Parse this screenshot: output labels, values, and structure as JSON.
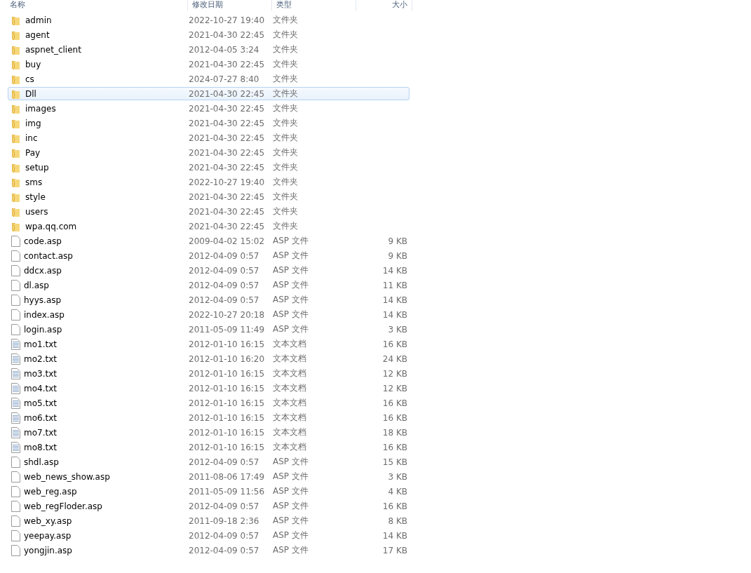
{
  "columns": [
    "名称",
    "修改日期",
    "类型",
    "大小"
  ],
  "rows": [
    {
      "name": "admin",
      "date": "2022-10-27 19:40",
      "type": "文件夹",
      "kind": "folder",
      "selected": false
    },
    {
      "name": "agent",
      "date": "2021-04-30 22:45",
      "type": "文件夹",
      "kind": "folder",
      "selected": false
    },
    {
      "name": "aspnet_client",
      "date": "2012-04-05 3:24",
      "type": "文件夹",
      "kind": "folder",
      "selected": false
    },
    {
      "name": "buy",
      "date": "2021-04-30 22:45",
      "type": "文件夹",
      "kind": "folder",
      "selected": false
    },
    {
      "name": "cs",
      "date": "2024-07-27 8:40",
      "type": "文件夹",
      "kind": "folder",
      "selected": false
    },
    {
      "name": "Dll",
      "date": "2021-04-30 22:45",
      "type": "文件夹",
      "kind": "folder",
      "selected": true
    },
    {
      "name": "images",
      "date": "2021-04-30 22:45",
      "type": "文件夹",
      "kind": "folder",
      "selected": false
    },
    {
      "name": "img",
      "date": "2021-04-30 22:45",
      "type": "文件夹",
      "kind": "folder",
      "selected": false
    },
    {
      "name": "inc",
      "date": "2021-04-30 22:45",
      "type": "文件夹",
      "kind": "folder",
      "selected": false
    },
    {
      "name": "Pay",
      "date": "2021-04-30 22:45",
      "type": "文件夹",
      "kind": "folder",
      "selected": false
    },
    {
      "name": "setup",
      "date": "2021-04-30 22:45",
      "type": "文件夹",
      "kind": "folder",
      "selected": false
    },
    {
      "name": "sms",
      "date": "2022-10-27 19:40",
      "type": "文件夹",
      "kind": "folder",
      "selected": false
    },
    {
      "name": "style",
      "date": "2021-04-30 22:45",
      "type": "文件夹",
      "kind": "folder",
      "selected": false
    },
    {
      "name": "users",
      "date": "2021-04-30 22:45",
      "type": "文件夹",
      "kind": "folder",
      "selected": false
    },
    {
      "name": "wpa.qq.com",
      "date": "2021-04-30 22:45",
      "type": "文件夹",
      "kind": "folder",
      "selected": false
    },
    {
      "name": "code.asp",
      "date": "2009-04-02 15:02",
      "type": "ASP 文件",
      "size": "9 KB",
      "kind": "file",
      "selected": false
    },
    {
      "name": "contact.asp",
      "date": "2012-04-09 0:57",
      "type": "ASP 文件",
      "size": "9 KB",
      "kind": "file",
      "selected": false
    },
    {
      "name": "ddcx.asp",
      "date": "2012-04-09 0:57",
      "type": "ASP 文件",
      "size": "14 KB",
      "kind": "file",
      "selected": false
    },
    {
      "name": "dl.asp",
      "date": "2012-04-09 0:57",
      "type": "ASP 文件",
      "size": "11 KB",
      "kind": "file",
      "selected": false
    },
    {
      "name": "hyys.asp",
      "date": "2012-04-09 0:57",
      "type": "ASP 文件",
      "size": "14 KB",
      "kind": "file",
      "selected": false
    },
    {
      "name": "index.asp",
      "date": "2022-10-27 20:18",
      "type": "ASP 文件",
      "size": "14 KB",
      "kind": "file",
      "selected": false
    },
    {
      "name": "login.asp",
      "date": "2011-05-09 11:49",
      "type": "ASP 文件",
      "size": "3 KB",
      "kind": "file",
      "selected": false
    },
    {
      "name": "mo1.txt",
      "date": "2012-01-10 16:15",
      "type": "文本文档",
      "size": "16 KB",
      "kind": "text",
      "selected": false
    },
    {
      "name": "mo2.txt",
      "date": "2012-01-10 16:20",
      "type": "文本文档",
      "size": "24 KB",
      "kind": "text",
      "selected": false
    },
    {
      "name": "mo3.txt",
      "date": "2012-01-10 16:15",
      "type": "文本文档",
      "size": "12 KB",
      "kind": "text",
      "selected": false
    },
    {
      "name": "mo4.txt",
      "date": "2012-01-10 16:15",
      "type": "文本文档",
      "size": "12 KB",
      "kind": "text",
      "selected": false
    },
    {
      "name": "mo5.txt",
      "date": "2012-01-10 16:15",
      "type": "文本文档",
      "size": "16 KB",
      "kind": "text",
      "selected": false
    },
    {
      "name": "mo6.txt",
      "date": "2012-01-10 16:15",
      "type": "文本文档",
      "size": "16 KB",
      "kind": "text",
      "selected": false
    },
    {
      "name": "mo7.txt",
      "date": "2012-01-10 16:15",
      "type": "文本文档",
      "size": "18 KB",
      "kind": "text",
      "selected": false
    },
    {
      "name": "mo8.txt",
      "date": "2012-01-10 16:15",
      "type": "文本文档",
      "size": "16 KB",
      "kind": "text",
      "selected": false
    },
    {
      "name": "shdl.asp",
      "date": "2012-04-09 0:57",
      "type": "ASP 文件",
      "size": "15 KB",
      "kind": "file",
      "selected": false
    },
    {
      "name": "web_news_show.asp",
      "date": "2011-08-06 17:49",
      "type": "ASP 文件",
      "size": "3 KB",
      "kind": "file",
      "selected": false
    },
    {
      "name": "web_reg.asp",
      "date": "2011-05-09 11:56",
      "type": "ASP 文件",
      "size": "4 KB",
      "kind": "file",
      "selected": false
    },
    {
      "name": "web_regFloder.asp",
      "date": "2012-04-09 0:57",
      "type": "ASP 文件",
      "size": "16 KB",
      "kind": "file",
      "selected": false
    },
    {
      "name": "web_xy.asp",
      "date": "2011-09-18 2:36",
      "type": "ASP 文件",
      "size": "8 KB",
      "kind": "file",
      "selected": false
    },
    {
      "name": "yeepay.asp",
      "date": "2012-04-09 0:57",
      "type": "ASP 文件",
      "size": "14 KB",
      "kind": "file",
      "selected": false
    },
    {
      "name": "yongjin.asp",
      "date": "2012-04-09 0:57",
      "type": "ASP 文件",
      "size": "17 KB",
      "kind": "file",
      "selected": false
    }
  ]
}
